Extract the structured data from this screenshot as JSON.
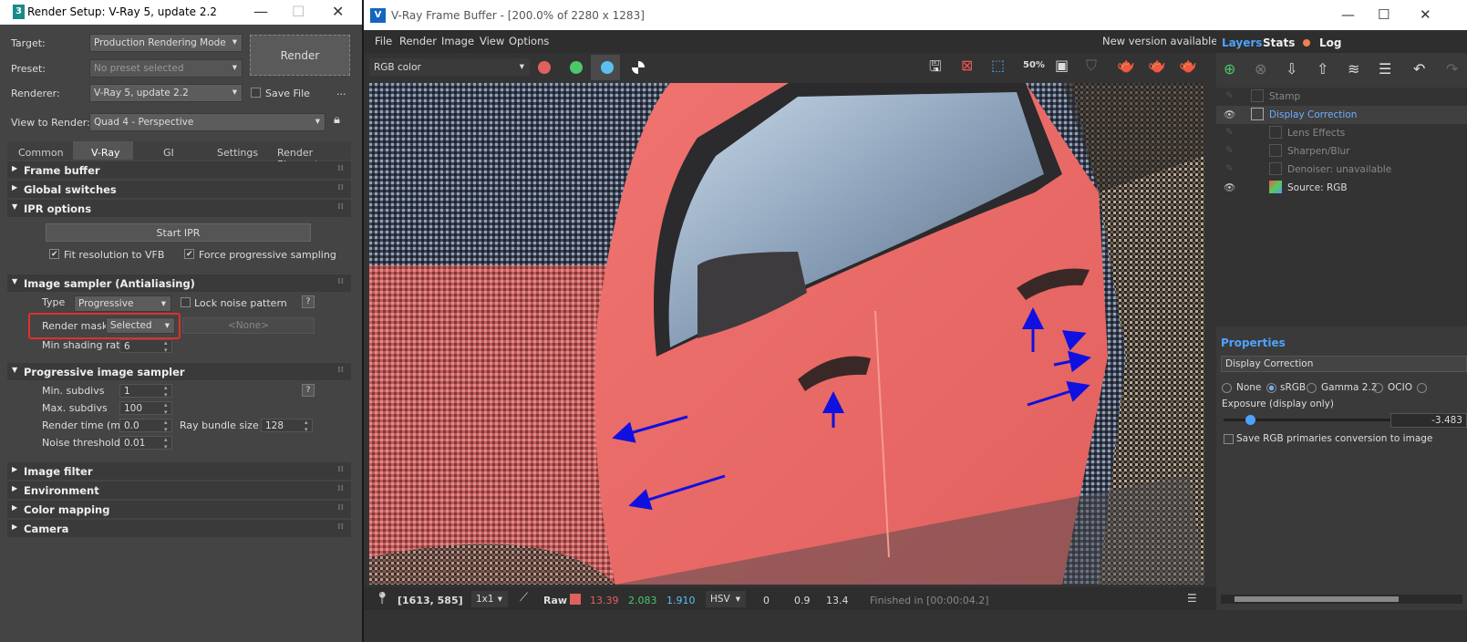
{
  "render_setup": {
    "title": "Render Setup: V-Ray 5, update 2.2",
    "target_label": "Target:",
    "target_value": "Production Rendering Mode",
    "preset_label": "Preset:",
    "preset_value": "No preset selected",
    "renderer_label": "Renderer:",
    "renderer_value": "V-Ray 5, update 2.2",
    "save_file_label": "Save File",
    "more_label": "...",
    "view_label": "View to Render:",
    "view_value": "Quad 4 - Perspective",
    "render_button": "Render",
    "tabs": [
      "Common",
      "V-Ray",
      "GI",
      "Settings",
      "Render Elements"
    ],
    "rollouts": {
      "frame_buffer": "Frame buffer",
      "global_switches": "Global switches",
      "ipr_options": "IPR options",
      "image_sampler": "Image sampler (Antialiasing)",
      "progressive": "Progressive image sampler",
      "image_filter": "Image filter",
      "environment": "Environment",
      "color_mapping": "Color mapping",
      "camera": "Camera"
    },
    "ipr": {
      "start_ipr": "Start IPR",
      "fit_resolution": "Fit resolution to VFB",
      "force_progressive": "Force progressive sampling"
    },
    "sampler": {
      "type_label": "Type",
      "type_value": "Progressive",
      "lock_noise": "Lock noise pattern",
      "help": "?",
      "render_mask_label": "Render mask",
      "render_mask_value": "Selected",
      "none_value": "<None>",
      "min_shading_label": "Min shading rate",
      "min_shading_value": "6"
    },
    "progressive": {
      "min_subdivs_label": "Min. subdivs",
      "min_subdivs_value": "1",
      "max_subdivs_label": "Max. subdivs",
      "max_subdivs_value": "100",
      "render_time_label": "Render time (min)",
      "render_time_value": "0.0",
      "ray_bundle_label": "Ray bundle size",
      "ray_bundle_value": "128",
      "noise_threshold_label": "Noise threshold",
      "noise_threshold_value": "0.01",
      "help": "?"
    }
  },
  "vfb": {
    "title": "V-Ray Frame Buffer - [200.0% of 2280 x 1283]",
    "menu": [
      "File",
      "Render",
      "Image",
      "View",
      "Options"
    ],
    "new_version": "New version available!",
    "channel": "RGB color",
    "zoom_label": "50%",
    "status": {
      "coords": "[1613, 585]",
      "ratio": "1x1",
      "raw": "Raw",
      "r": "13.39",
      "g": "2.083",
      "b": "1.910",
      "space": "HSV",
      "h": "0",
      "s": "0.9",
      "v": "13.4",
      "finished": "Finished in [00:00:04.2]"
    },
    "colors": {
      "red": "#e06060",
      "green": "#4cc76a",
      "blue": "#5bc0f0",
      "arrow": "#1010e0",
      "mask": "#e0302a"
    }
  },
  "layers_panel": {
    "tabs": [
      "Layers",
      "Stats",
      "Log"
    ],
    "layers": [
      {
        "name": "Stamp",
        "enabled": false
      },
      {
        "name": "Display Correction",
        "enabled": true
      },
      {
        "name": "Lens Effects",
        "enabled": false
      },
      {
        "name": "Sharpen/Blur",
        "enabled": false
      },
      {
        "name": "Denoiser: unavailable",
        "enabled": false
      },
      {
        "name": "Source: RGB",
        "enabled": true
      }
    ],
    "properties_title": "Properties",
    "properties_value": "Display Correction",
    "options": [
      "None",
      "sRGB",
      "Gamma 2.2",
      "OCIO"
    ],
    "exposure_label": "Exposure (display only)",
    "exposure_value": "-3.483",
    "save_rgb_label": "Save RGB primaries conversion to image"
  }
}
